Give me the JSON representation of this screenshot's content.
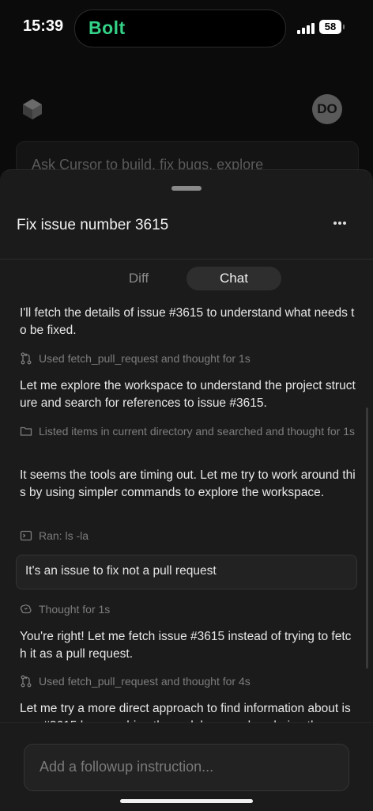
{
  "status_bar": {
    "time": "15:39",
    "island_app": "Bolt",
    "battery": "58"
  },
  "background": {
    "avatar_initials": "DO",
    "input_placeholder": "Ask Cursor to build, fix bugs, explore"
  },
  "sheet": {
    "title": "Fix issue number 3615",
    "more_icon": "ellipsis-icon",
    "tabs": [
      {
        "label": "Diff",
        "active": false
      },
      {
        "label": "Chat",
        "active": true
      }
    ]
  },
  "chat": {
    "messages": [
      {
        "type": "assistant",
        "text": "I'll fetch the details of issue #3615 to understand what needs to be fixed."
      },
      {
        "type": "tool",
        "icon": "git-pull-request-icon",
        "text": "Used fetch_pull_request and thought for 1s"
      },
      {
        "type": "assistant",
        "text": "Let me explore the workspace to understand the project structure and search for references to issue #3615."
      },
      {
        "type": "tool",
        "icon": "folder-icon",
        "text": "Listed items in current directory and searched and thought for 1s"
      },
      {
        "type": "assistant",
        "text": "It seems the tools are timing out. Let me try to work around this by using simpler commands to explore the workspace."
      },
      {
        "type": "tool",
        "icon": "terminal-icon",
        "text": "Ran: ls -la"
      },
      {
        "type": "user",
        "text": "It's an issue to fix not a pull request"
      },
      {
        "type": "tool",
        "icon": "brain-icon",
        "text": "Thought for 1s"
      },
      {
        "type": "assistant",
        "text": "You're right! Let me fetch issue #3615 instead of trying to fetch it as a pull request."
      },
      {
        "type": "tool",
        "icon": "git-pull-request-icon",
        "text": "Used fetch_pull_request and thought for 4s"
      },
      {
        "type": "assistant",
        "text": "Let me try a more direct approach to find information about issue #3615 by searching the codebase and exploring the"
      }
    ]
  },
  "footer": {
    "followup_placeholder": "Add a followup instruction..."
  },
  "colors": {
    "brand_green": "#34d186",
    "sheet_bg": "#1b1b1b",
    "muted_text": "#7d7d7d"
  }
}
